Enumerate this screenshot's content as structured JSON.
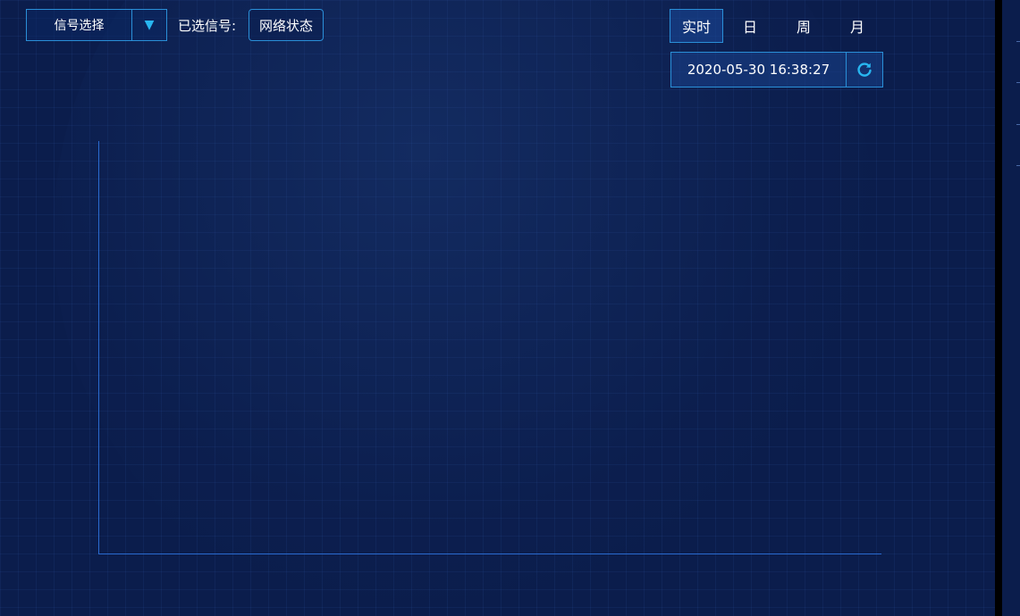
{
  "toolbar": {
    "signal_select": {
      "label": "信号选择",
      "arrow_icon": "triangle-down-icon"
    },
    "selected_signal_label": "已选信号:",
    "selected_signal": "网络状态"
  },
  "time_range": {
    "tabs": [
      {
        "label": "实时",
        "active": true
      },
      {
        "label": "日",
        "active": false
      },
      {
        "label": "周",
        "active": false
      },
      {
        "label": "月",
        "active": false
      }
    ],
    "datetime": "2020-05-30 16:38:27",
    "refresh_icon": "refresh-icon"
  },
  "colors": {
    "background": "#0b1d4c",
    "accent": "#2a8fd8",
    "icon_accent": "#28b6f0"
  }
}
